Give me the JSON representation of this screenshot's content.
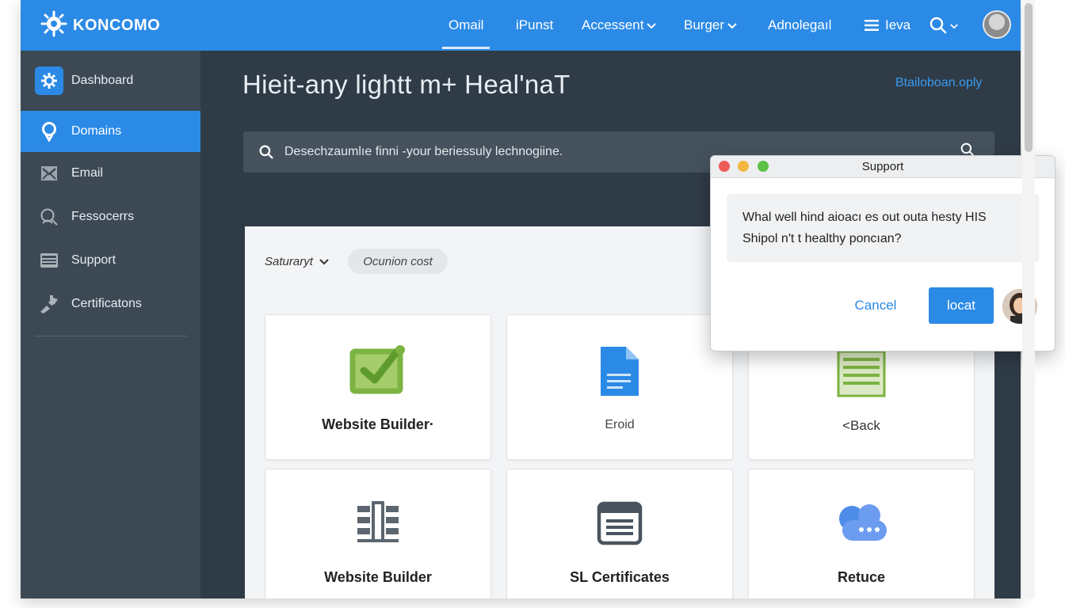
{
  "brand": {
    "name": "KONCOMO"
  },
  "nav": {
    "items": [
      "Omail",
      "iPunst",
      "Accessent",
      "Burger",
      "Adnolegaıl",
      "Ieva"
    ]
  },
  "sidebar": {
    "items": [
      {
        "label": "Dashboard",
        "icon": "gear-icon"
      },
      {
        "label": "Domains",
        "icon": "pin-icon"
      },
      {
        "label": "Email",
        "icon": "mail-icon"
      },
      {
        "label": "Fessocerrs",
        "icon": "person-search-icon"
      },
      {
        "label": "Support",
        "icon": "server-icon"
      },
      {
        "label": "Certificatons",
        "icon": "tools-icon"
      }
    ],
    "active_index": 1
  },
  "main": {
    "title": "Hieit-any lightt m+ Heal'naT",
    "top_link": "Btailoboan.oply",
    "search": {
      "placeholder": "Desechzaumlıe finni -your beriessuly lechnogiine."
    }
  },
  "filters": {
    "select_label": "Saturaryt",
    "chip_label": "Ocunion cost"
  },
  "cards": [
    {
      "label": "Website Builder·",
      "icon": "checkbox-icon"
    },
    {
      "label": "Eroid",
      "icon": "document-icon"
    },
    {
      "label": "<Back",
      "icon": "ledger-icon"
    },
    {
      "label": "Website Builder",
      "icon": "columns-icon"
    },
    {
      "label": "SL Certificates",
      "icon": "calendar-icon"
    },
    {
      "label": "Retuce",
      "icon": "chat-cloud-icon"
    }
  ],
  "dialog": {
    "title": "Support",
    "message": "Whal well hind aioacı es out outa hesty HIS Shipol n't t healthy poncıan?",
    "cancel_label": "Cancel",
    "ok_label": "locat"
  },
  "colors": {
    "accent": "#2b8ae6",
    "sidebar": "#3c4954",
    "main_bg": "#2f3b47",
    "green": "#7cb342"
  }
}
